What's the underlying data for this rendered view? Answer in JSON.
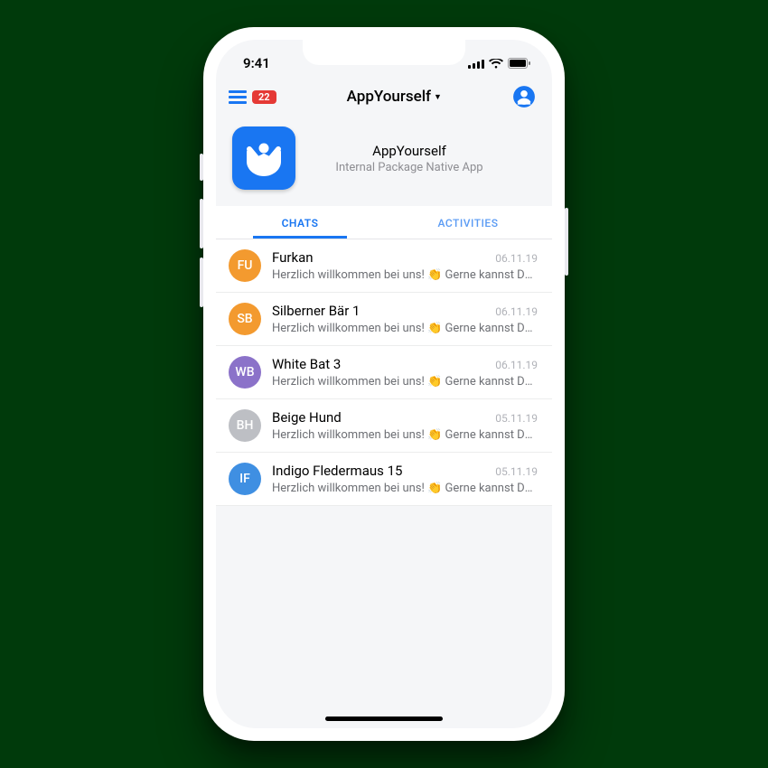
{
  "status": {
    "time": "9:41"
  },
  "appbar": {
    "badge": "22",
    "title": "AppYourself"
  },
  "header": {
    "title": "AppYourself",
    "subtitle": "Internal Package Native App"
  },
  "tabs": {
    "chats": "CHATS",
    "activities": "ACTIVITIES"
  },
  "chats": [
    {
      "initials": "FU",
      "color": "#f39a2f",
      "name": "Furkan",
      "date": "06.11.19",
      "preview": "Herzlich willkommen bei uns! 👏 Gerne kannst Du ..."
    },
    {
      "initials": "SB",
      "color": "#f39a2f",
      "name": "Silberner Bär 1",
      "date": "06.11.19",
      "preview": "Herzlich willkommen bei uns! 👏 Gerne kannst Du ..."
    },
    {
      "initials": "WB",
      "color": "#8b72c9",
      "name": "White Bat 3",
      "date": "06.11.19",
      "preview": "Herzlich willkommen bei uns! 👏 Gerne kannst Du ..."
    },
    {
      "initials": "BH",
      "color": "#bdbfc4",
      "name": "Beige Hund",
      "date": "05.11.19",
      "preview": "Herzlich willkommen bei uns! 👏 Gerne kannst Du ..."
    },
    {
      "initials": "IF",
      "color": "#3f8fe2",
      "name": "Indigo Fledermaus 15",
      "date": "05.11.19",
      "preview": "Herzlich willkommen bei uns! 👏 Gerne kannst Du ..."
    }
  ]
}
